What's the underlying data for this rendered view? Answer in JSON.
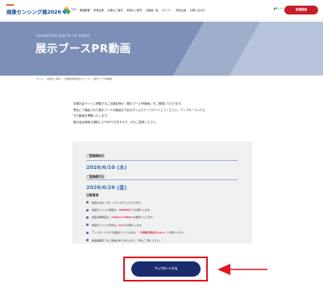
{
  "header": {
    "logo_tag": "MEDIA",
    "logo_text": "画像センシング展",
    "logo_year": "2026",
    "nav": [
      "TOP",
      "開催概要",
      "来場企業",
      "出展のご案内",
      "来場のご案内",
      "出展者一覧",
      "セミナー",
      "特別企画",
      "お問い合わせ"
    ],
    "lang_active": "JP",
    "lang_other": "EN",
    "register_label": "来場登録"
  },
  "hero": {
    "subtitle": "EXHIBITION BOOTH PR VIDEO",
    "title": "展示ブースPR動画"
  },
  "breadcrumb": [
    "ホーム",
    "出展のご案内",
    "出展者専用提出フォーム",
    "展示ブースPR動画"
  ],
  "intro": [
    "本展示会サイトに掲載するご出展社様の「展示ブースPR動画」をご登録いただけます。",
    "弊社にて撮影された展示ブースの動画を下記ボタンよりアップロードしてください。アップロードいただ",
    "きた動画を掲載いたします。",
    "展示会会期後も継続したPRができますので、ぜひご登録ください。"
  ],
  "info": {
    "start_label": "ご登録開始日",
    "start_date": "2026/6/10 (水)",
    "end_label": "ご登録締切日",
    "end_date": "2026/6/26 (金)",
    "notes_label": "注意事項",
    "notes": [
      {
        "pre": "動画は1社につき、1つとさせていただきます。",
        "hl": "",
        "post": ""
      },
      {
        "pre": "動画のファイル容量は、",
        "hl": "100MB以下",
        "post": "でお願いします。"
      },
      {
        "pre": "動画の解像度は、",
        "hl": "1920px×1080px",
        "post": "を推奨いたします。"
      },
      {
        "pre": "動画のファイル形式は、",
        "hl": "mp4",
        "post": "でお願いします。"
      },
      {
        "pre": "アップロードされる動画のファイル名は、",
        "hl": "「小間番号貴社名.mp4」",
        "post": "でお願いします。"
      },
      {
        "pre": "動画掲載完了のご連絡はありませんので、予めご了承ください。",
        "hl": "",
        "post": ""
      }
    ]
  },
  "upload": {
    "button_label": "アップロードする"
  },
  "colors": {
    "brand_blue": "#1d4e9e",
    "accent_red": "#c81e2b",
    "date_blue": "#2f6fb5",
    "button_navy": "#1a2c6e",
    "highlight_red": "#e0151d"
  }
}
